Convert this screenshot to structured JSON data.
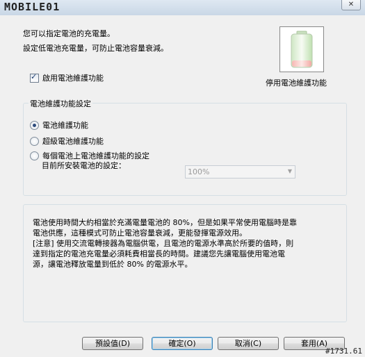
{
  "window": {
    "title": "MOBILE01",
    "close_icon": "close-icon"
  },
  "intro": {
    "line1": "您可以指定電池的充電量。",
    "line2": "設定低電池充電量，可防止電池容量衰減。"
  },
  "battery": {
    "icon": "battery-icon",
    "label": "停用電池維護功能"
  },
  "enable_checkbox": {
    "label": "啟用電池維護功能",
    "checked": true
  },
  "group": {
    "title": "電池維護功能設定",
    "options": [
      {
        "label": "電池維護功能",
        "selected": true
      },
      {
        "label": "超級電池維護功能",
        "selected": false
      },
      {
        "label": "每個電池上電池維護功能的設定",
        "selected": false
      }
    ],
    "sub_label": "目前所安裝電池的設定：",
    "select_value": "100%"
  },
  "info": {
    "lines": [
      "電池使用時間大約相當於充滿電量電池的 80%，但是如果平常使用電腦時是靠",
      "電池供應，這種模式可防止電池容量衰減，更能發揮電源效用。",
      "[注意] 使用交流電轉接器為電腦供電，且電池的電源水準高於所要的值時，則",
      "達到指定的電池充電量必須耗費相當長的時間。建議您先讓電腦使用電池電",
      "源，讓電池釋放電量到低於 80% 的電源水平。"
    ]
  },
  "buttons": {
    "default_label": "預設值(D)",
    "ok_label": "確定(O)",
    "cancel_label": "取消(C)",
    "apply_label": "套用(A)"
  },
  "watermark": "#1731.61"
}
